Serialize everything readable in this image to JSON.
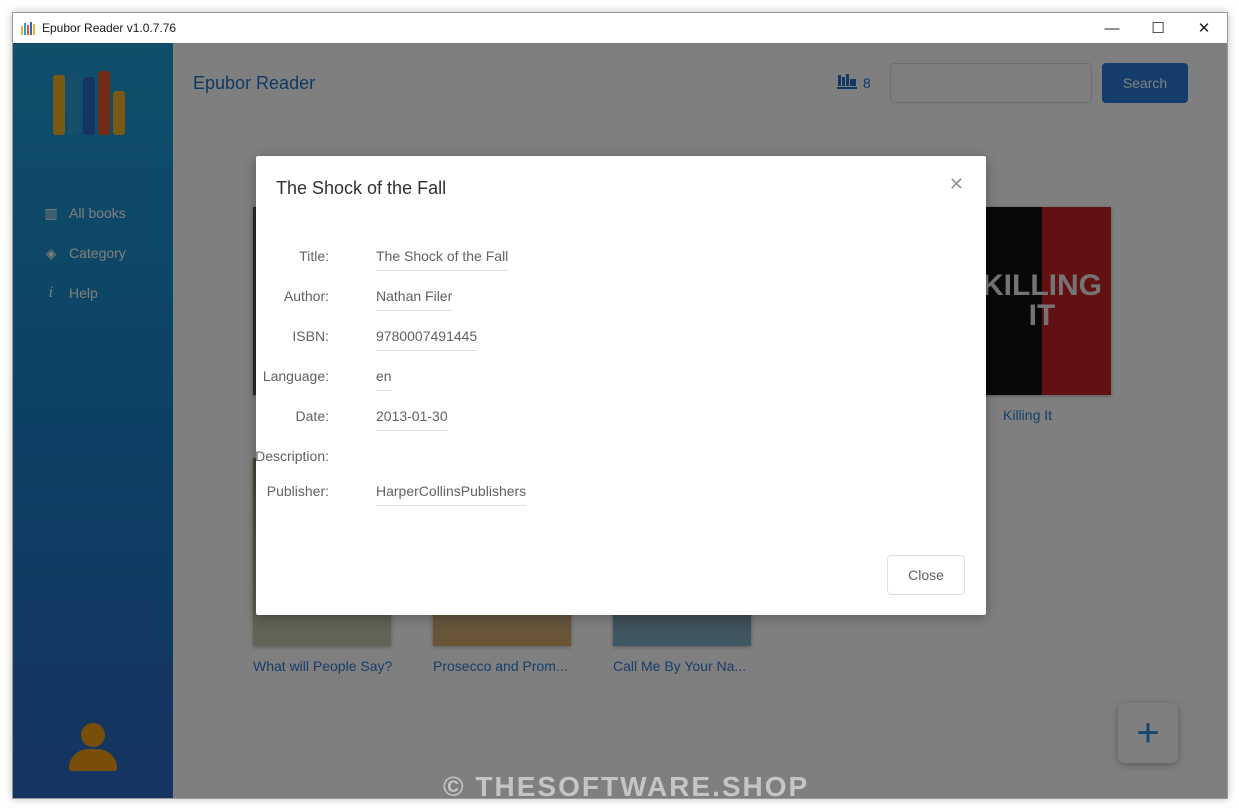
{
  "window": {
    "title": "Epubor Reader v1.0.7.76",
    "controls": [
      "—",
      "☐",
      "✕"
    ]
  },
  "sidebar": {
    "items": [
      {
        "label": "All books",
        "icon": "books-icon"
      },
      {
        "label": "Category",
        "icon": "layers-icon"
      },
      {
        "label": "Help",
        "icon": "info-icon"
      }
    ]
  },
  "header": {
    "app_name": "Epubor Reader",
    "book_count": "8",
    "search_placeholder": "",
    "search_label": "Search"
  },
  "books": [
    {
      "title": "Killing It"
    },
    {
      "title": "What will People Say?"
    },
    {
      "title": "Prosecco and Prom..."
    },
    {
      "title": "Call Me By Your Na..."
    }
  ],
  "dialog": {
    "title": "The Shock of the Fall",
    "fields": [
      {
        "label": "Title:",
        "value": "The Shock of the Fall"
      },
      {
        "label": "Author:",
        "value": "Nathan Filer"
      },
      {
        "label": "ISBN:",
        "value": "9780007491445"
      },
      {
        "label": "Language:",
        "value": "en"
      },
      {
        "label": "Date:",
        "value": "2013-01-30"
      },
      {
        "label": "Description:",
        "value": ""
      },
      {
        "label": "Publisher:",
        "value": "HarperCollinsPublishers"
      }
    ],
    "close_label": "Close"
  },
  "fab_symbol": "+",
  "watermark": "© THESOFTWARE.SHOP",
  "colors": {
    "accent": "#2a7bd6",
    "sidebar_top": "#1f9fd5",
    "sidebar_bottom": "#2a68c2",
    "avatar": "#f39c12"
  }
}
